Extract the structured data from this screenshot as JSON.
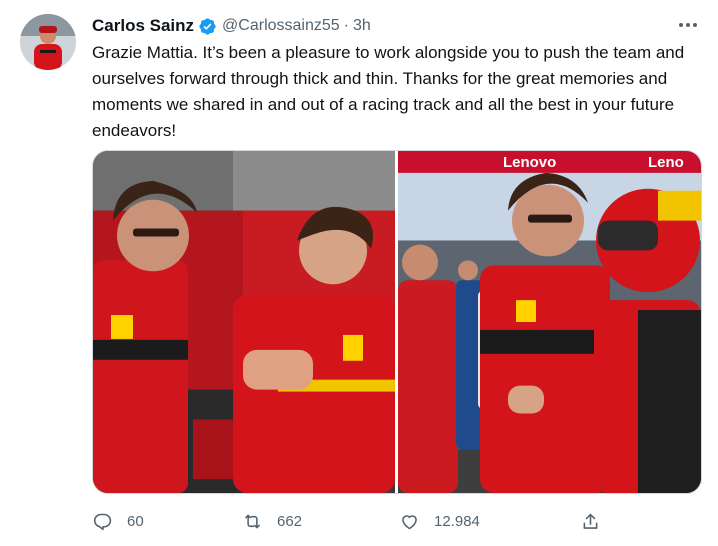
{
  "author": {
    "display_name": "Carlos Sainz",
    "handle": "@Carlossainz55",
    "separator": "·",
    "time": "3h",
    "verified": true,
    "avatar_icon": "driver-avatar"
  },
  "tweet": {
    "text": "Grazie Mattia. It’s been a pleasure to work alongside you to push the team and ourselves forward through thick and thin. Thanks for the great memories and moments we shared in and out of a racing track and all the best in your future endeavors!"
  },
  "photos": {
    "left": {
      "icon": "photo-garage-hug"
    },
    "right": {
      "icon": "photo-paddock-hug",
      "banner_text_1": "Lenovo",
      "banner_text_2": "Leno"
    }
  },
  "actions": {
    "reply": {
      "icon": "reply-icon",
      "count": "60"
    },
    "retweet": {
      "icon": "retweet-icon",
      "count": "662"
    },
    "like": {
      "icon": "heart-icon",
      "count": "12.984"
    },
    "share": {
      "icon": "share-icon"
    }
  },
  "colors": {
    "verified": "#1d9bf0",
    "text_primary": "#0f1419",
    "text_secondary": "#536471",
    "ferrari_red": "#d3141b"
  }
}
